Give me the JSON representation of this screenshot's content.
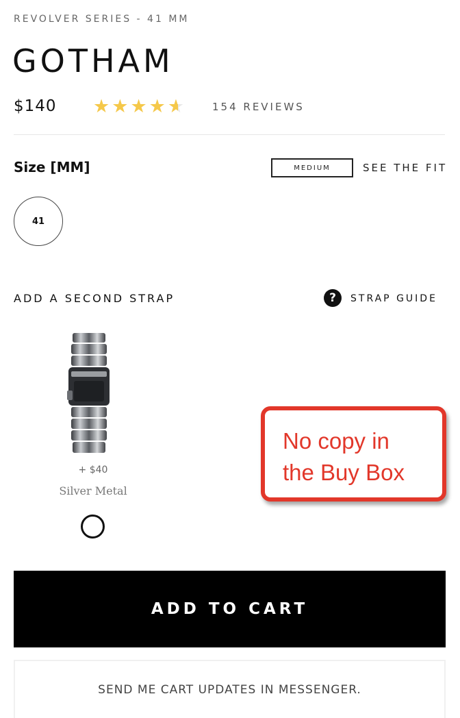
{
  "product": {
    "series": "REVOLVER SERIES - 41 MM",
    "name": "GOTHAM",
    "price": "$140",
    "rating": 4.5,
    "reviews": "154 REVIEWS"
  },
  "size": {
    "label": "Size [MM]",
    "fit_value": "MEDIUM",
    "see_fit": "SEE THE FIT",
    "options": [
      "41"
    ]
  },
  "strap": {
    "heading": "ADD A SECOND STRAP",
    "guide_icon": "question-circle",
    "guide_label": "STRAP GUIDE",
    "items": [
      {
        "price": "+ $40",
        "name": "Silver Metal",
        "selected": false
      }
    ]
  },
  "callout": {
    "line1": "No copy in",
    "line2": "the Buy Box",
    "color": "#e2372a"
  },
  "cart": {
    "add_label": "ADD TO CART",
    "messenger_label": "SEND ME CART UPDATES IN MESSENGER."
  },
  "colors": {
    "star": "#f5c84a",
    "button_bg": "#000000"
  }
}
